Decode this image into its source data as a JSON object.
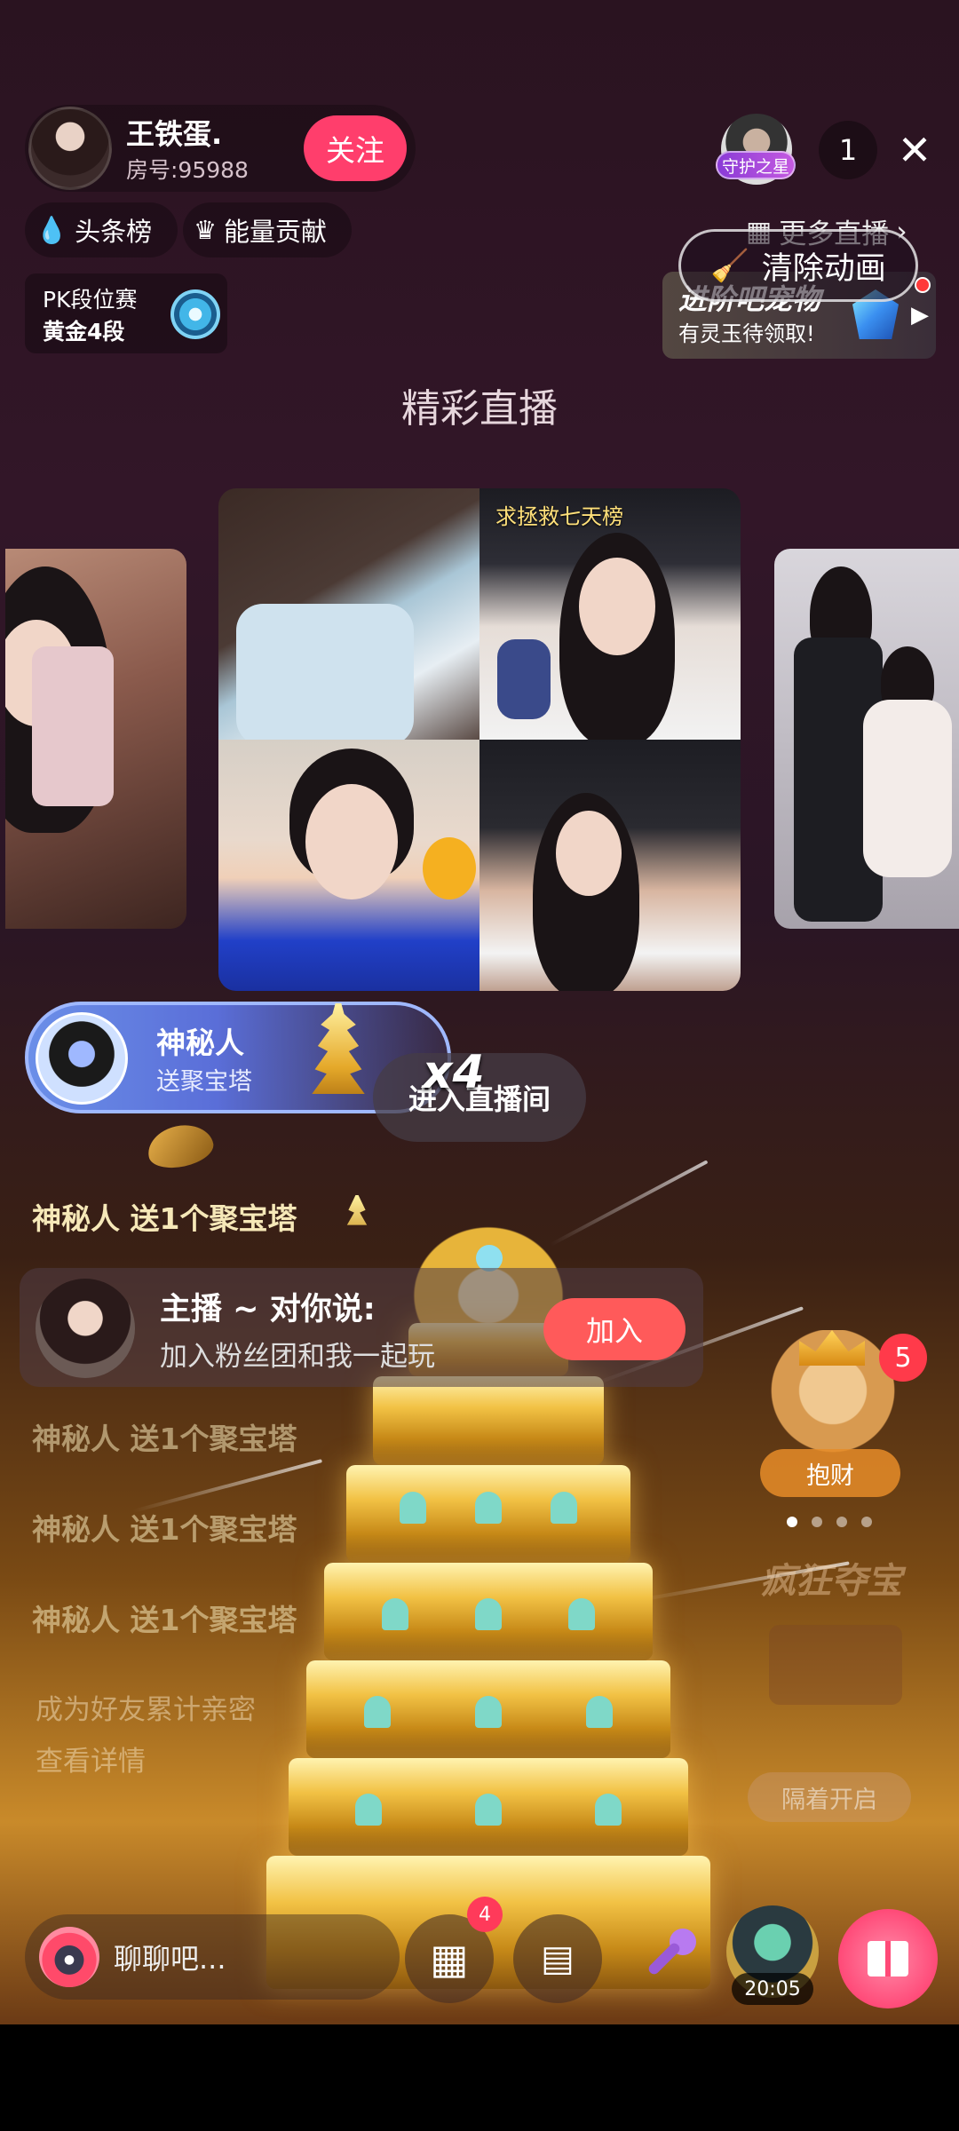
{
  "header": {
    "host_name": "王铁蛋.",
    "room_number": "房号:95988",
    "follow_label": "关注",
    "guard_badge": "守护之星",
    "viewer_count": "1",
    "close_icon": "close-icon"
  },
  "ranks": {
    "headline": "头条榜",
    "energy": "能量贡献",
    "more_live": "更多直播",
    "clear_animation": "清除动画"
  },
  "pk": {
    "title": "PK段位赛",
    "rank": "黄金4段"
  },
  "pet_promo": {
    "title": "进阶吧宠物",
    "subtitle": "有灵玉待领取!"
  },
  "section_title": "精彩直播",
  "grid": {
    "tag": "求拯救七天榜"
  },
  "gift_notice": {
    "user": "神秘人",
    "desc": "送聚宝塔",
    "multiplier": "x4",
    "enter_live": "进入直播间"
  },
  "chat": {
    "line1": "神秘人 送1个聚宝塔",
    "host_card_title": "主播 ~ 对你说:",
    "host_card_text": "加入粉丝团和我一起玩",
    "join_label": "加入",
    "line2": "神秘人 送1个聚宝塔",
    "line3": "神秘人 送1个聚宝塔",
    "line4": "神秘人 送1个聚宝塔",
    "friend_text": "成为好友累计亲密",
    "view_detail": "查看详情"
  },
  "side_widgets": {
    "badge_count": "5",
    "hug_label": "抱财",
    "crazy_treasure": "疯狂夺宝",
    "stay_open": "隔着开启"
  },
  "bottom_bar": {
    "chat_placeholder": "聊聊吧...",
    "apps_badge": "4",
    "timer": "20:05"
  },
  "colors": {
    "follow": "#ff3e6c",
    "join": "#ff5a5a",
    "gift_pill": "#5a6ed8",
    "gold": "#e5a92a"
  }
}
